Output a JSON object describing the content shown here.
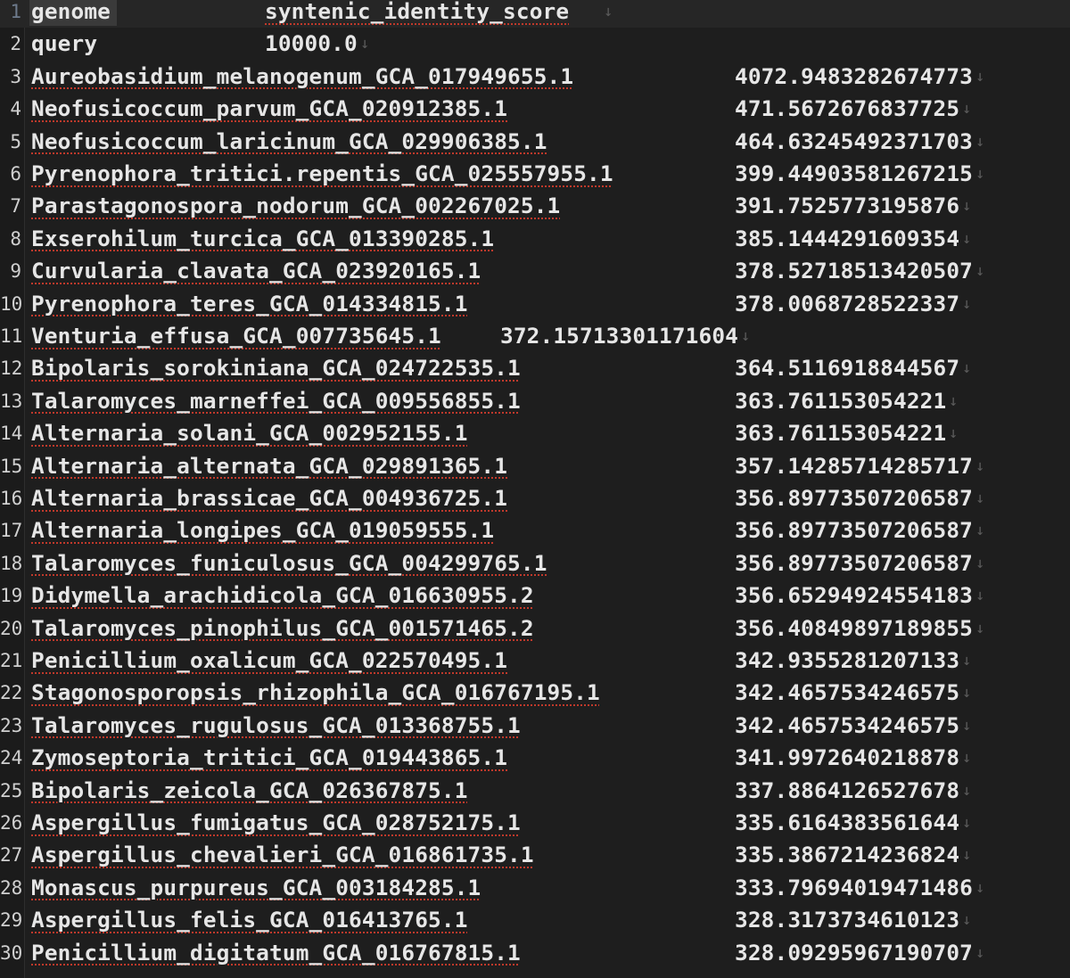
{
  "file": {
    "header": {
      "col1": "genome",
      "col2": "syntenic_identity_score"
    },
    "rows": [
      {
        "line": "2",
        "genome": "query",
        "score": "10000.0"
      },
      {
        "line": "3",
        "genome": "Aureobasidium_melanogenum_GCA_017949655.1",
        "score": "4072.9483282674773"
      },
      {
        "line": "4",
        "genome": "Neofusicoccum_parvum_GCA_020912385.1",
        "score": "471.5672676837725"
      },
      {
        "line": "5",
        "genome": "Neofusicoccum_laricinum_GCA_029906385.1",
        "score": "464.63245492371703"
      },
      {
        "line": "6",
        "genome": "Pyrenophora_tritici.repentis_GCA_025557955.1",
        "score": "399.44903581267215"
      },
      {
        "line": "7",
        "genome": "Parastagonospora_nodorum_GCA_002267025.1",
        "score": "391.7525773195876"
      },
      {
        "line": "8",
        "genome": "Exserohilum_turcica_GCA_013390285.1",
        "score": "385.1444291609354"
      },
      {
        "line": "9",
        "genome": "Curvularia_clavata_GCA_023920165.1",
        "score": "378.52718513420507"
      },
      {
        "line": "10",
        "genome": "Pyrenophora_teres_GCA_014334815.1",
        "score": "378.0068728522337"
      },
      {
        "line": "11",
        "genome": "Venturia_effusa_GCA_007735645.1",
        "score": "372.15713301171604"
      },
      {
        "line": "12",
        "genome": "Bipolaris_sorokiniana_GCA_024722535.1",
        "score": "364.5116918844567"
      },
      {
        "line": "13",
        "genome": "Talaromyces_marneffei_GCA_009556855.1",
        "score": "363.761153054221"
      },
      {
        "line": "14",
        "genome": "Alternaria_solani_GCA_002952155.1",
        "score": "363.761153054221"
      },
      {
        "line": "15",
        "genome": "Alternaria_alternata_GCA_029891365.1",
        "score": "357.14285714285717"
      },
      {
        "line": "16",
        "genome": "Alternaria_brassicae_GCA_004936725.1",
        "score": "356.89773507206587"
      },
      {
        "line": "17",
        "genome": "Alternaria_longipes_GCA_019059555.1",
        "score": "356.89773507206587"
      },
      {
        "line": "18",
        "genome": "Talaromyces_funiculosus_GCA_004299765.1",
        "score": "356.89773507206587"
      },
      {
        "line": "19",
        "genome": "Didymella_arachidicola_GCA_016630955.2",
        "score": "356.65294924554183"
      },
      {
        "line": "20",
        "genome": "Talaromyces_pinophilus_GCA_001571465.2",
        "score": "356.40849897189855"
      },
      {
        "line": "21",
        "genome": "Penicillium_oxalicum_GCA_022570495.1",
        "score": "342.9355281207133"
      },
      {
        "line": "22",
        "genome": "Stagonosporopsis_rhizophila_GCA_016767195.1",
        "score": "342.4657534246575"
      },
      {
        "line": "23",
        "genome": "Talaromyces_rugulosus_GCA_013368755.1",
        "score": "342.4657534246575"
      },
      {
        "line": "24",
        "genome": "Zymoseptoria_tritici_GCA_019443865.1",
        "score": "341.9972640218878"
      },
      {
        "line": "25",
        "genome": "Bipolaris_zeicola_GCA_026367875.1",
        "score": "337.8864126527678"
      },
      {
        "line": "26",
        "genome": "Aspergillus_fumigatus_GCA_028752175.1",
        "score": "335.6164383561644"
      },
      {
        "line": "27",
        "genome": "Aspergillus_chevalieri_GCA_016861735.1",
        "score": "335.3867214236824"
      },
      {
        "line": "28",
        "genome": "Monascus_purpureus_GCA_003184285.1",
        "score": "333.79694019471486"
      },
      {
        "line": "29",
        "genome": "Aspergillus_felis_GCA_016413765.1",
        "score": "328.3173734610123"
      },
      {
        "line": "30",
        "genome": "Penicillium_digitatum_GCA_016767815.1",
        "score": "328.09295967190707"
      }
    ],
    "header_line": "1",
    "eol_marker": "↓"
  },
  "colors": {
    "background": "#1e1e1e",
    "text": "#e6e6e6",
    "spell_underline": "#c0392b",
    "current_line_number": "#6d7a8c"
  }
}
